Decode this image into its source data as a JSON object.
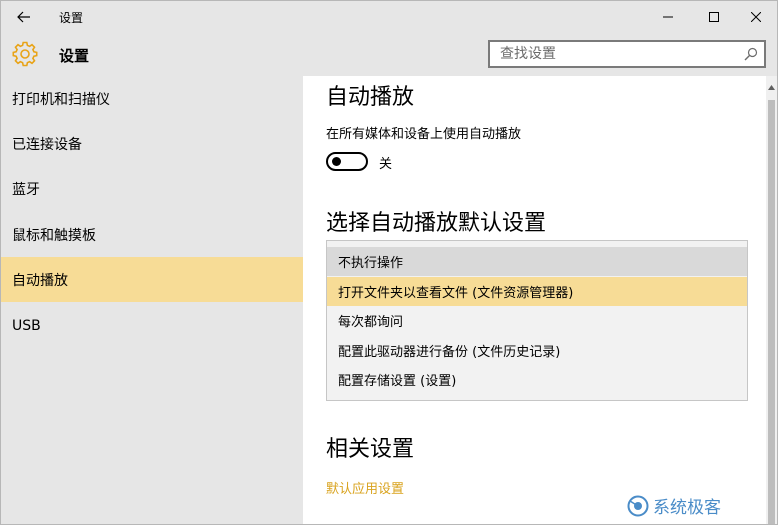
{
  "window": {
    "title": "设置",
    "header_title": "设置"
  },
  "search": {
    "placeholder": "查找设置"
  },
  "sidebar": {
    "items": [
      {
        "label": "打印机和扫描仪"
      },
      {
        "label": "已连接设备"
      },
      {
        "label": "蓝牙"
      },
      {
        "label": "鼠标和触摸板"
      },
      {
        "label": "自动播放",
        "active": true
      },
      {
        "label": "USB"
      }
    ]
  },
  "main": {
    "autoplay_title": "自动播放",
    "autoplay_desc": "在所有媒体和设备上使用自动播放",
    "toggle_state": "关",
    "defaults_title": "选择自动播放默认设置",
    "options": [
      {
        "label": "不执行操作"
      },
      {
        "label": "打开文件夹以查看文件 (文件资源管理器)"
      },
      {
        "label": "每次都询问"
      },
      {
        "label": "配置此驱动器进行备份 (文件历史记录)"
      },
      {
        "label": "配置存储设置 (设置)"
      }
    ],
    "related_title": "相关设置",
    "related_link": "默认应用设置"
  },
  "watermark": {
    "text": "系统极客"
  },
  "colors": {
    "chrome": "#e6e6e6",
    "accent": "#f7dc96",
    "link": "#d9a31e",
    "gear": "#e8a317"
  }
}
